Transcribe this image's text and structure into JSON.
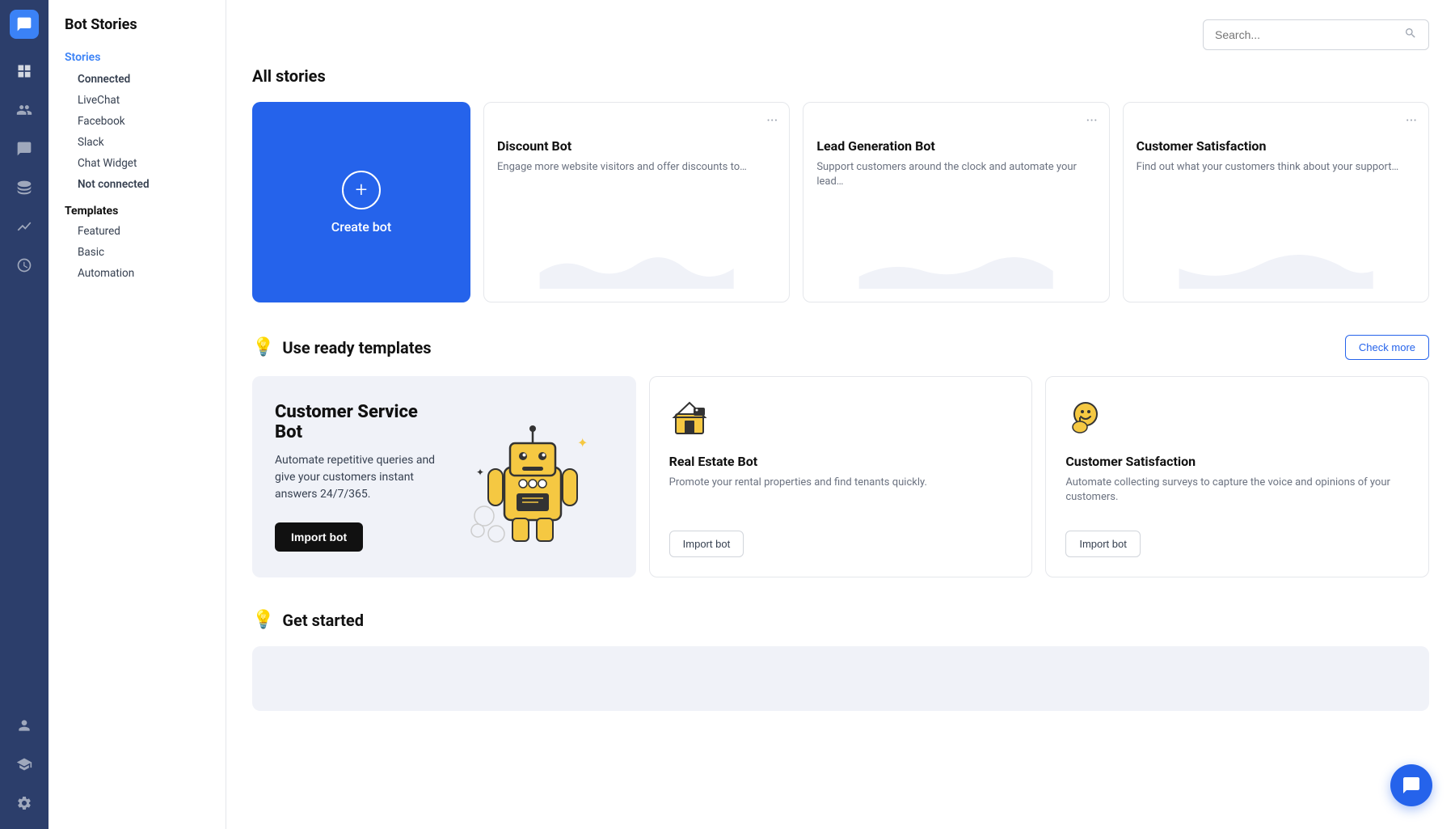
{
  "app": {
    "title": "Bot Stories"
  },
  "sidebar": {
    "icons": [
      {
        "name": "logo-icon",
        "symbol": "💬"
      },
      {
        "name": "dashboard-icon",
        "symbol": "⊞"
      },
      {
        "name": "users-icon",
        "symbol": "👥"
      },
      {
        "name": "chat-icon",
        "symbol": "💬"
      },
      {
        "name": "database-icon",
        "symbol": "🗄"
      },
      {
        "name": "clock-icon",
        "symbol": "🕐"
      },
      {
        "name": "analytics-icon",
        "symbol": "📈"
      },
      {
        "name": "team-icon",
        "symbol": "👤"
      },
      {
        "name": "academy-icon",
        "symbol": "🎓"
      },
      {
        "name": "settings-icon",
        "symbol": "⚙"
      }
    ]
  },
  "leftnav": {
    "page_title": "Bot Stories",
    "stories_label": "Stories",
    "connected_label": "Connected",
    "livechat_label": "LiveChat",
    "facebook_label": "Facebook",
    "slack_label": "Slack",
    "chat_widget_label": "Chat Widget",
    "not_connected_label": "Not connected",
    "templates_label": "Templates",
    "featured_label": "Featured",
    "basic_label": "Basic",
    "automation_label": "Automation"
  },
  "search": {
    "placeholder": "Search..."
  },
  "all_stories": {
    "title": "All stories",
    "create_bot_label": "Create bot",
    "cards": [
      {
        "title": "Discount Bot",
        "desc": "Engage more website visitors and offer discounts to…"
      },
      {
        "title": "Lead Generation Bot",
        "desc": "Support customers around the clock and automate your lead…"
      },
      {
        "title": "Customer Satisfaction",
        "desc": "Find out what your customers think about your support…"
      }
    ]
  },
  "templates_section": {
    "title": "Use ready templates",
    "check_more_label": "Check more",
    "featured_card": {
      "title": "Customer Service Bot",
      "desc": "Automate repetitive queries and give your customers instant answers 24/7/365.",
      "import_label": "Import bot"
    },
    "small_cards": [
      {
        "icon": "🏠",
        "title": "Real Estate Bot",
        "desc": "Promote your rental properties and find tenants quickly.",
        "import_label": "Import bot"
      },
      {
        "icon": "😊",
        "title": "Customer Satisfaction",
        "desc": "Automate collecting surveys to capture the voice and opinions of your customers.",
        "import_label": "Import bot"
      }
    ]
  },
  "get_started_section": {
    "title": "Get started"
  }
}
